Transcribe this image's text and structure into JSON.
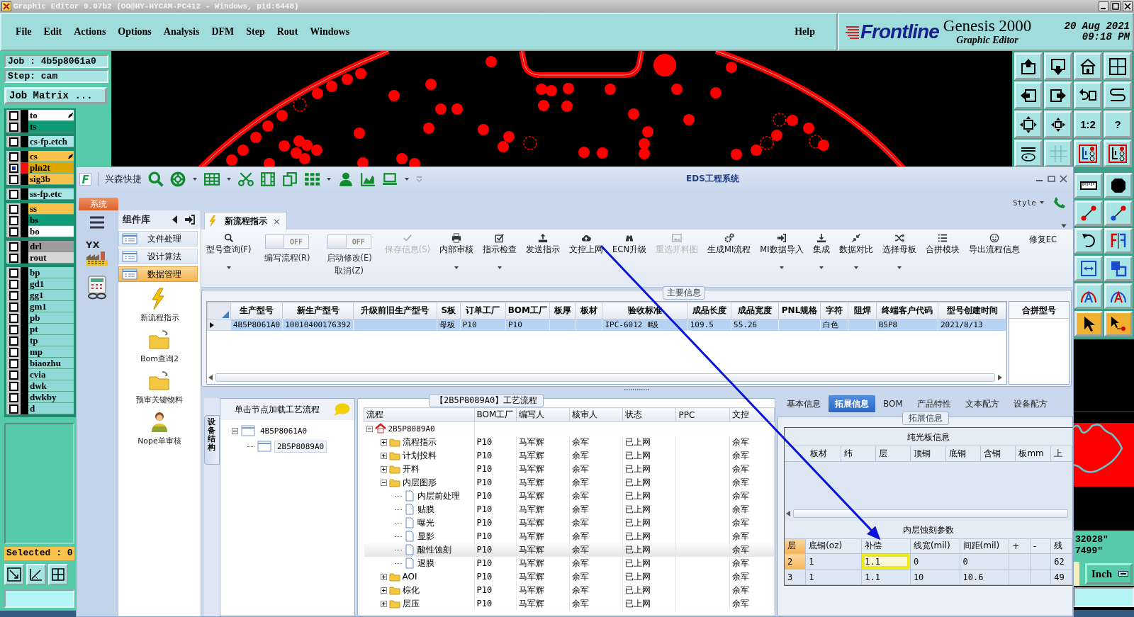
{
  "window": {
    "title": "Graphic Editor 9.07b2 (OO@HY-HYCAM-PC412 - Windows, pid:6448)"
  },
  "menu": [
    "File",
    "Edit",
    "Actions",
    "Options",
    "Analysis",
    "DFM",
    "Step",
    "Rout",
    "Windows"
  ],
  "help": "Help",
  "brand": {
    "logo": "Frontline",
    "product": "Genesis 2000",
    "subtitle": "Graphic Editor",
    "date": "20 Aug 2021",
    "time": "09:18 PM"
  },
  "job": {
    "job": "Job : 4b5p8061a0",
    "step": "Step: cam",
    "matrix_button": "Job Matrix ..."
  },
  "layer_groups": [
    {
      "layers": [
        {
          "name": "to",
          "color": "#ffffff",
          "active": false,
          "marked": true
        },
        {
          "name": "ts",
          "color": "#0e9a76",
          "active": false,
          "marked": false
        }
      ]
    },
    {
      "layers": [
        {
          "name": "cs-fp.etch",
          "color": "#a8e6e6",
          "active": false,
          "marked": false
        }
      ]
    },
    {
      "layers": [
        {
          "name": "cs",
          "color": "#f8c24c",
          "active": false,
          "marked": true
        },
        {
          "name": "pln2t",
          "color": "#e0a600",
          "active": true,
          "marked": false
        },
        {
          "name": "sig3b",
          "color": "#f8c24c",
          "active": false,
          "marked": false
        }
      ]
    },
    {
      "layers": [
        {
          "name": "ss-fp.etc",
          "color": "#a8e6e6",
          "active": false,
          "marked": false
        }
      ]
    },
    {
      "layers": [
        {
          "name": "ss",
          "color": "#f8c24c",
          "active": false,
          "marked": false
        },
        {
          "name": "bs",
          "color": "#0e9a76",
          "active": false,
          "marked": false
        },
        {
          "name": "bo",
          "color": "#ffffff",
          "active": false,
          "marked": false
        }
      ]
    },
    {
      "layers": [
        {
          "name": "drl",
          "color": "#9c9c9c",
          "active": false,
          "marked": false
        },
        {
          "name": "rout",
          "color": "#d6d6d6",
          "active": false,
          "marked": false
        }
      ]
    },
    {
      "layers": [
        {
          "name": "bp",
          "color": "#8fd8d8",
          "active": false,
          "marked": false
        },
        {
          "name": "gd1",
          "color": "#8fd8d8",
          "active": false,
          "marked": false
        },
        {
          "name": "gg1",
          "color": "#8fd8d8",
          "active": false,
          "marked": false
        },
        {
          "name": "gm1",
          "color": "#8fd8d8",
          "active": false,
          "marked": false
        },
        {
          "name": "pb",
          "color": "#8fd8d8",
          "active": false,
          "marked": false
        },
        {
          "name": "pt",
          "color": "#8fd8d8",
          "active": false,
          "marked": false
        },
        {
          "name": "tp",
          "color": "#8fd8d8",
          "active": false,
          "marked": false
        },
        {
          "name": "mp",
          "color": "#8fd8d8",
          "active": false,
          "marked": false
        },
        {
          "name": "biaozhu",
          "color": "#8fd8d8",
          "active": false,
          "marked": false
        },
        {
          "name": "cvia",
          "color": "#8fd8d8",
          "active": false,
          "marked": false
        },
        {
          "name": "dwk",
          "color": "#8fd8d8",
          "active": false,
          "marked": false
        },
        {
          "name": "dwkby",
          "color": "#8fd8d8",
          "active": false,
          "marked": false
        },
        {
          "name": "d",
          "color": "#8fd8d8",
          "active": false,
          "marked": false
        }
      ]
    }
  ],
  "selected_count": "Selected : 0",
  "tools": [
    {
      "kind": "icon"
    },
    {
      "kind": "icon"
    },
    {
      "kind": "icon"
    },
    {
      "kind": "icon"
    },
    {
      "kind": "icon"
    },
    {
      "kind": "icon"
    },
    {
      "kind": "icon"
    },
    {
      "kind": "icon"
    },
    {
      "kind": "icon"
    },
    {
      "kind": "icon"
    },
    {
      "kind": "text",
      "label": "1:2"
    },
    {
      "kind": "text",
      "label": "?"
    },
    {
      "kind": "icon"
    },
    {
      "kind": "icon"
    },
    {
      "kind": "icon"
    },
    {
      "kind": "icon"
    }
  ],
  "side_tools": [
    {
      "selected": false
    },
    {
      "selected": false
    },
    {
      "selected": false
    },
    {
      "selected": false
    },
    {
      "selected": false
    },
    {
      "selected": false
    },
    {
      "selected": false
    },
    {
      "selected": false
    },
    {
      "selected": false
    },
    {
      "selected": false
    },
    {
      "selected": true
    },
    {
      "selected": true
    }
  ],
  "coordinates": [
    "32028\"",
    "7499\""
  ],
  "units_button": "Inch",
  "eds": {
    "title": "EDS工程系统",
    "logo_letter": "F",
    "quick_label": "兴森快捷",
    "system_tab": "系统",
    "style_menu": "Style",
    "app_badge": "YX",
    "library": {
      "title": "组件库",
      "items": [
        {
          "label": "文件处理",
          "selected": false
        },
        {
          "label": "设计算法",
          "selected": false
        },
        {
          "label": "数据管理",
          "selected": true
        }
      ],
      "tools": [
        {
          "label": "新流程指示",
          "kind": "bolt"
        },
        {
          "label": "Bom查询2",
          "kind": "folder"
        },
        {
          "label": "预审关键物料",
          "kind": "folder"
        },
        {
          "label": "Nope单审核",
          "kind": "person"
        }
      ]
    },
    "document_tab": {
      "label": "新流程指示",
      "close": "×",
      "selected": true
    },
    "ribbon": [
      {
        "kind": "button",
        "label": "型号查询(F)",
        "dropdown": true,
        "disabled": false,
        "annotated": false
      },
      {
        "kind": "toggle",
        "label": "编写流程(R)",
        "state_text": "OFF",
        "on": false
      },
      {
        "kind": "toggle",
        "label": "启动修改(E)",
        "sublabel": "取消(Z)",
        "state_text": "OFF",
        "on": false
      },
      {
        "kind": "button",
        "label": "保存信息(S)",
        "dropdown": false,
        "disabled": true,
        "annotated": false
      },
      {
        "kind": "button",
        "label": "内部审核",
        "dropdown": true,
        "disabled": false,
        "annotated": false
      },
      {
        "kind": "button",
        "label": "指示检查",
        "dropdown": true,
        "disabled": false,
        "annotated": false
      },
      {
        "kind": "button",
        "label": "发送指示",
        "dropdown": false,
        "disabled": false,
        "annotated": false
      },
      {
        "kind": "button",
        "label": "文控上网",
        "dropdown": false,
        "disabled": false,
        "annotated": true
      },
      {
        "kind": "button",
        "label": "ECN升级",
        "dropdown": false,
        "disabled": false,
        "annotated": false
      },
      {
        "kind": "button",
        "label": "重选开料图",
        "dropdown": false,
        "disabled": true,
        "annotated": false
      },
      {
        "kind": "button",
        "label": "生成MI流程",
        "dropdown": false,
        "disabled": false,
        "annotated": false
      },
      {
        "kind": "button",
        "label": "MI数据导入",
        "dropdown": true,
        "disabled": false,
        "annotated": false
      },
      {
        "kind": "button",
        "label": "集成",
        "dropdown": true,
        "disabled": false,
        "annotated": false
      },
      {
        "kind": "button",
        "label": "数据对比",
        "dropdown": true,
        "disabled": false,
        "annotated": false
      },
      {
        "kind": "button",
        "label": "选择母板",
        "dropdown": true,
        "disabled": false,
        "annotated": false
      },
      {
        "kind": "button",
        "label": "合拼模块",
        "dropdown": false,
        "disabled": false,
        "annotated": false
      },
      {
        "kind": "button",
        "label": "导出流程信息",
        "dropdown": false,
        "disabled": false,
        "annotated": false
      },
      {
        "kind": "button",
        "label": "修复EC",
        "dropdown": false,
        "disabled": false,
        "annotated": false
      }
    ],
    "main_info": {
      "title": "主要信息",
      "columns": [
        "生产型号",
        "新生产型号",
        "升级前旧生产型号",
        "S板",
        "订单工厂",
        "BOM工厂",
        "板厚",
        "板材",
        "验收标准",
        "成品长度",
        "成品宽度",
        "PNL规格",
        "字符",
        "阻焊",
        "终端客户代码",
        "型号创建时间"
      ],
      "rows": [
        {
          "selected": true,
          "cells": [
            "4B5P8061A0",
            "10010400176392",
            null,
            "母板",
            "P10",
            "P10",
            null,
            null,
            "IPC-6012 Ⅱ级",
            "109.5",
            "55.26",
            null,
            "白色",
            null,
            "B5P8",
            "2021/8/13"
          ]
        }
      ],
      "side_column": "合拼型号"
    },
    "device_tree": {
      "tab": "设备结构",
      "hint": "单击节点加载工艺流程",
      "nodes": [
        {
          "label": "4B5P8061A0",
          "expanded": true,
          "selected": false,
          "children": [
            {
              "label": "2B5P8089A0",
              "selected": true
            }
          ]
        }
      ]
    },
    "process": {
      "title": "【2B5P8089A0】工艺流程",
      "columns": [
        "流程",
        "BOM工厂",
        "编写人",
        "核审人",
        "状态",
        "PPC",
        "文控"
      ],
      "nodes": [
        {
          "label": "2B5P8089A0",
          "kind": "root",
          "expanded": true,
          "selected": false,
          "children": [
            {
              "label": "流程指示",
              "kind": "folder",
              "expanded": false,
              "selected": false,
              "cells": [
                "P10",
                "马军辉",
                "余军",
                "已上网",
                null,
                "余军"
              ]
            },
            {
              "label": "计划投料",
              "kind": "folder",
              "expanded": false,
              "selected": false,
              "cells": [
                "P10",
                "马军辉",
                "余军",
                "已上网",
                null,
                "余军"
              ]
            },
            {
              "label": "开料",
              "kind": "folder",
              "expanded": false,
              "selected": false,
              "cells": [
                "P10",
                "马军辉",
                "余军",
                "已上网",
                null,
                "余军"
              ]
            },
            {
              "label": "内层图形",
              "kind": "folder",
              "expanded": true,
              "selected": false,
              "cells": [
                "P10",
                "马军辉",
                "余军",
                "已上网",
                null,
                "余军"
              ],
              "children": [
                {
                  "label": "内层前处理",
                  "kind": "file",
                  "selected": false,
                  "cells": [
                    "P10",
                    "马军辉",
                    "余军",
                    "已上网",
                    null,
                    "余军"
                  ]
                },
                {
                  "label": "贴膜",
                  "kind": "file",
                  "selected": false,
                  "cells": [
                    "P10",
                    "马军辉",
                    "余军",
                    "已上网",
                    null,
                    "余军"
                  ]
                },
                {
                  "label": "曝光",
                  "kind": "file",
                  "selected": false,
                  "cells": [
                    "P10",
                    "马军辉",
                    "余军",
                    "已上网",
                    null,
                    "余军"
                  ]
                },
                {
                  "label": "显影",
                  "kind": "file",
                  "selected": false,
                  "cells": [
                    "P10",
                    "马军辉",
                    "余军",
                    "已上网",
                    null,
                    "余军"
                  ]
                },
                {
                  "label": "酸性蚀刻",
                  "kind": "file",
                  "selected": true,
                  "cells": [
                    "P10",
                    "马军辉",
                    "余军",
                    "已上网",
                    null,
                    "余军"
                  ]
                },
                {
                  "label": "退膜",
                  "kind": "file",
                  "selected": false,
                  "cells": [
                    "P10",
                    "马军辉",
                    "余军",
                    "已上网",
                    null,
                    "余军"
                  ]
                }
              ]
            },
            {
              "label": "AOI",
              "kind": "folder",
              "expanded": false,
              "selected": false,
              "cells": [
                "P10",
                "马军辉",
                "余军",
                "已上网",
                null,
                "余军"
              ]
            },
            {
              "label": "棕化",
              "kind": "folder",
              "expanded": false,
              "selected": false,
              "cells": [
                "P10",
                "马军辉",
                "余军",
                "已上网",
                null,
                "余军"
              ]
            },
            {
              "label": "层压",
              "kind": "folder",
              "expanded": false,
              "selected": false,
              "cells": [
                "P10",
                "马军辉",
                "余军",
                "已上网",
                null,
                "余军"
              ]
            }
          ]
        }
      ]
    },
    "detail_tabs": [
      {
        "label": "基本信息",
        "selected": false
      },
      {
        "label": "拓展信息",
        "selected": true
      },
      {
        "label": "BOM",
        "selected": false
      },
      {
        "label": "产品特性",
        "selected": false
      },
      {
        "label": "文本配方",
        "selected": false
      },
      {
        "label": "设备配方",
        "selected": false
      }
    ],
    "extension": {
      "title": "拓展信息",
      "bare_board": {
        "title": "纯光板信息",
        "columns": [
          "板材",
          "纬",
          "层",
          "顶铜",
          "底铜",
          "含铜",
          "板mm",
          "上"
        ]
      },
      "etch": {
        "title": "内层蚀刻参数",
        "columns": [
          "层",
          "底铜(oz)",
          "补偿",
          "线宽(mil)",
          "间距(mil)",
          "+",
          "-",
          "残"
        ],
        "rows": [
          {
            "selected": true,
            "cells": [
              {
                "text": "2",
                "highlighted": false
              },
              {
                "text": "1",
                "highlighted": false
              },
              {
                "text": "1.1",
                "highlighted": true
              },
              {
                "text": "0",
                "highlighted": false
              },
              {
                "text": "0",
                "highlighted": false
              },
              {
                "highlighted": false
              },
              {
                "highlighted": false
              },
              {
                "text": "62",
                "highlighted": false
              }
            ]
          },
          {
            "selected": false,
            "cells": [
              {
                "text": "3",
                "highlighted": false
              },
              {
                "text": "1",
                "highlighted": false
              },
              {
                "text": "1.1",
                "highlighted": false
              },
              {
                "text": "10",
                "highlighted": false
              },
              {
                "text": "10.6",
                "highlighted": false
              },
              {
                "highlighted": false
              },
              {
                "highlighted": false
              },
              {
                "text": "49",
                "highlighted": false
              }
            ]
          }
        ]
      }
    }
  }
}
